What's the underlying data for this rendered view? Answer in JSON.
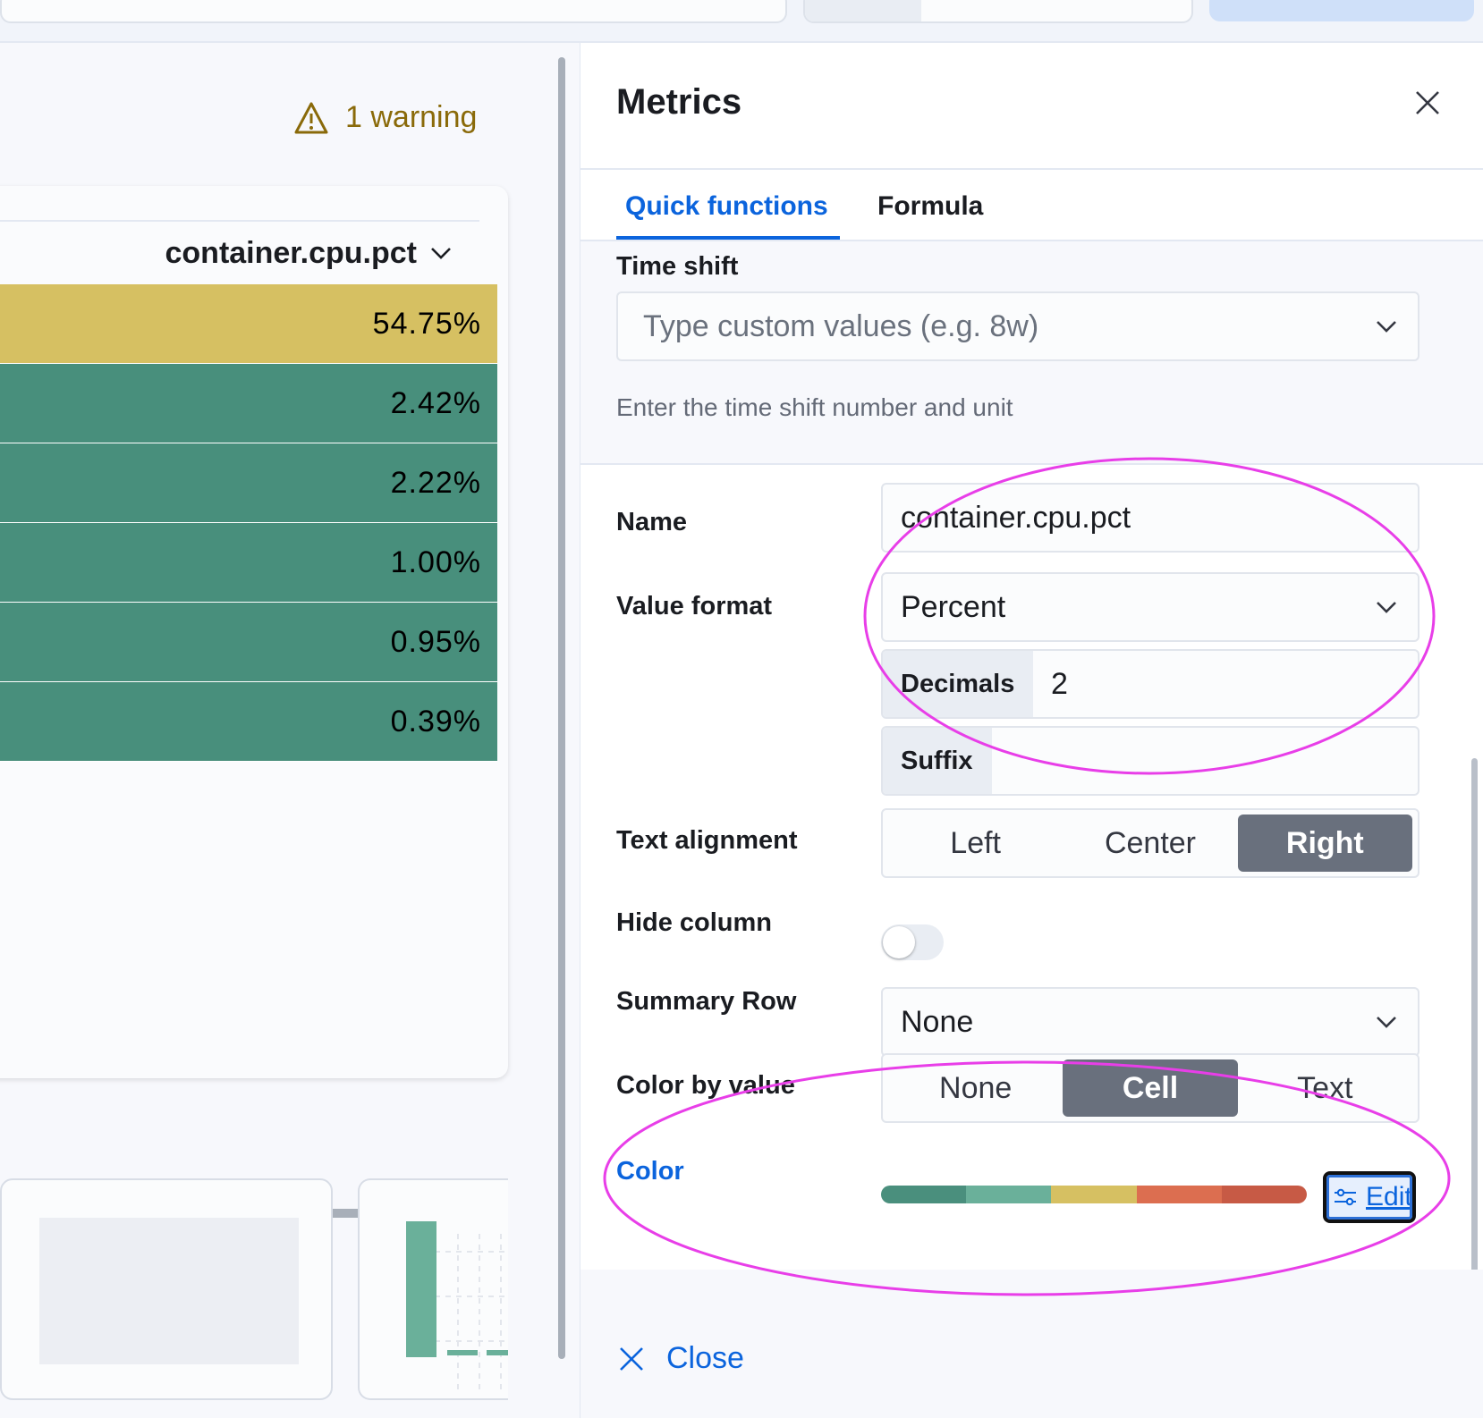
{
  "warning": {
    "text": "1 warning"
  },
  "table": {
    "column_header": "container.cpu.pct",
    "rows": [
      {
        "value": "54.75%",
        "color": "#d6c062"
      },
      {
        "value": "2.42%",
        "color": "#488f7c"
      },
      {
        "value": "2.22%",
        "color": "#488f7c"
      },
      {
        "value": "1.00%",
        "color": "#488f7c"
      },
      {
        "value": "0.95%",
        "color": "#488f7c"
      },
      {
        "value": "0.39%",
        "color": "#488f7c"
      }
    ]
  },
  "flyout": {
    "title": "Metrics",
    "tabs": [
      "Quick functions",
      "Formula"
    ],
    "time_shift": {
      "label": "Time shift",
      "placeholder": "Type custom values (e.g. 8w)",
      "help": "Enter the time shift number and unit"
    },
    "name": {
      "label": "Name",
      "value": "container.cpu.pct"
    },
    "value_format": {
      "label": "Value format",
      "selected": "Percent",
      "decimals_label": "Decimals",
      "decimals_value": "2",
      "suffix_label": "Suffix"
    },
    "text_alignment": {
      "label": "Text alignment",
      "options": [
        "Left",
        "Center",
        "Right"
      ],
      "selected": "Right"
    },
    "hide_column": {
      "label": "Hide column",
      "on": false
    },
    "summary_row": {
      "label": "Summary Row",
      "selected": "None"
    },
    "color_by_value": {
      "label": "Color by value",
      "options": [
        "None",
        "Cell",
        "Text"
      ],
      "selected": "Cell"
    },
    "color": {
      "label": "Color",
      "palette": [
        "#4a8f7d",
        "#6ab09a",
        "#d6c062",
        "#dc6e50",
        "#c75a45"
      ],
      "edit_label": "Edit"
    },
    "close_label": "Close"
  },
  "accent_color": "#0b64dd",
  "annotation_color": "#e83ee8"
}
